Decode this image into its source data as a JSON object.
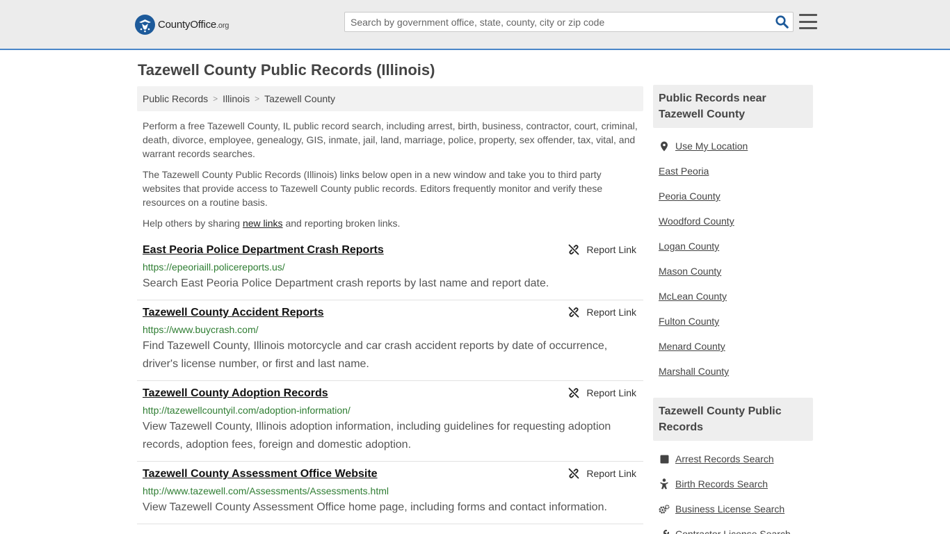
{
  "header": {
    "logo_name": "CountyOffice",
    "logo_tld": ".org",
    "search_placeholder": "Search by government office, state, county, city or zip code"
  },
  "page_title": "Tazewell County Public Records (Illinois)",
  "breadcrumb": [
    "Public Records",
    "Illinois",
    "Tazewell County"
  ],
  "intro": {
    "p1": "Perform a free Tazewell County, IL public record search, including arrest, birth, business, contractor, court, criminal, death, divorce, employee, genealogy, GIS, inmate, jail, land, marriage, police, property, sex offender, tax, vital, and warrant records searches.",
    "p2": "The Tazewell County Public Records (Illinois) links below open in a new window and take you to third party websites that provide access to Tazewell County public records. Editors frequently monitor and verify these resources on a routine basis.",
    "p3_before": "Help others by sharing ",
    "p3_link": "new links",
    "p3_after": " and reporting broken links."
  },
  "report_label": "Report Link",
  "results": [
    {
      "title": "East Peoria Police Department Crash Reports",
      "url": "https://epeoriaill.policereports.us/",
      "desc": "Search East Peoria Police Department crash reports by last name and report date."
    },
    {
      "title": "Tazewell County Accident Reports",
      "url": "https://www.buycrash.com/",
      "desc": "Find Tazewell County, Illinois motorcycle and car crash accident reports by date of occurrence, driver's license number, or first and last name."
    },
    {
      "title": "Tazewell County Adoption Records",
      "url": "http://tazewellcountyil.com/adoption-information/",
      "desc": "View Tazewell County, Illinois adoption information, including guidelines for requesting adoption records, adoption fees, foreign and domestic adoption."
    },
    {
      "title": "Tazewell County Assessment Office Website",
      "url": "http://www.tazewell.com/Assessments/Assessments.html",
      "desc": "View Tazewell County Assessment Office home page, including forms and contact information."
    }
  ],
  "sidebar": {
    "nearby_title": "Public Records near Tazewell County",
    "use_location": "Use My Location",
    "nearby": [
      "East Peoria",
      "Peoria County",
      "Woodford County",
      "Logan County",
      "Mason County",
      "McLean County",
      "Fulton County",
      "Menard County",
      "Marshall County"
    ],
    "records_title": "Tazewell County Public Records",
    "records": [
      {
        "label": "Arrest Records Search",
        "icon": "square-icon"
      },
      {
        "label": "Birth Records Search",
        "icon": "baby-icon"
      },
      {
        "label": "Business License Search",
        "icon": "gears-icon"
      },
      {
        "label": "Contractor License Search",
        "icon": "tools-icon"
      }
    ]
  },
  "colors": {
    "accent": "#4a86c8",
    "url_green": "#2e7d32",
    "header_bg": "#ececec"
  }
}
